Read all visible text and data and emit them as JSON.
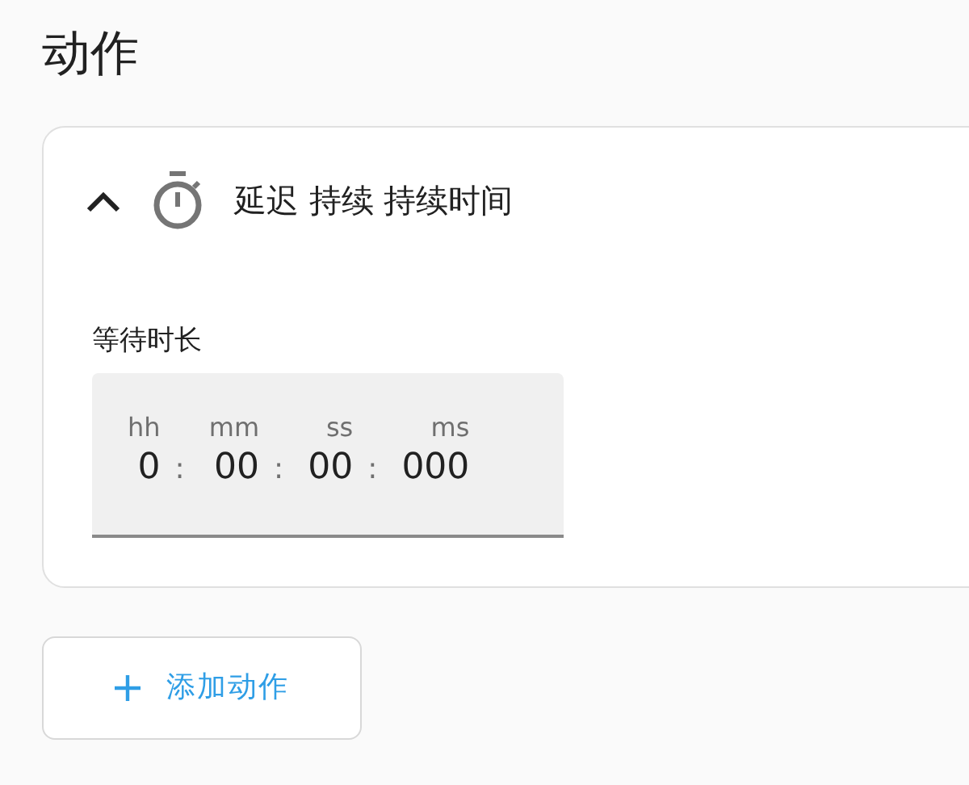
{
  "heading": "动作",
  "action": {
    "expanded": true,
    "title": "延迟 持续 持续时间",
    "field_label": "等待时长",
    "units": [
      {
        "label": "hh",
        "value": "0"
      },
      {
        "label": "mm",
        "value": "00"
      },
      {
        "label": "ss",
        "value": "00"
      },
      {
        "label": "ms",
        "value": "000"
      }
    ],
    "separator": ":"
  },
  "add_button": {
    "label": "添加动作"
  }
}
